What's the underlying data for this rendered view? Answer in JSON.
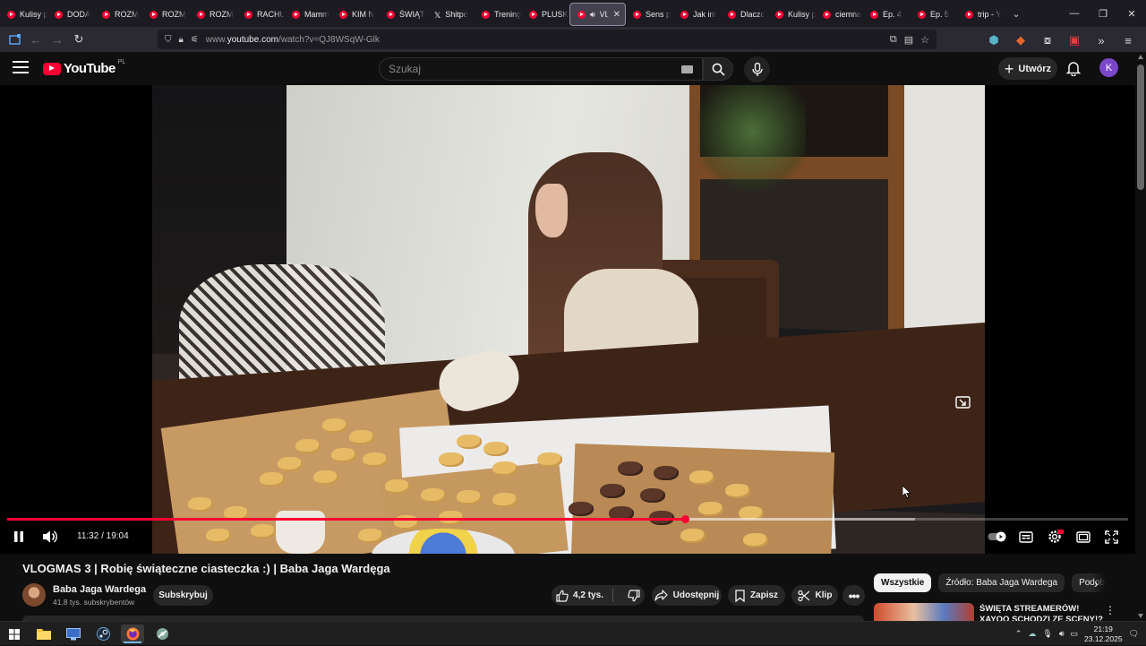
{
  "browser": {
    "tabs": [
      {
        "label": "Kulisy p",
        "icon": "youtube-icon"
      },
      {
        "label": "DODA",
        "icon": "youtube-icon"
      },
      {
        "label": "ROZM",
        "icon": "youtube-icon"
      },
      {
        "label": "ROZM",
        "icon": "youtube-icon"
      },
      {
        "label": "ROZM",
        "icon": "youtube-icon"
      },
      {
        "label": "RACHU",
        "icon": "youtube-icon"
      },
      {
        "label": "Mamm",
        "icon": "youtube-icon"
      },
      {
        "label": "KIM N",
        "icon": "youtube-icon"
      },
      {
        "label": "ŚWIĄT",
        "icon": "youtube-icon"
      },
      {
        "label": "Shitpo",
        "icon": "x-icon"
      },
      {
        "label": "Trening",
        "icon": "youtube-icon"
      },
      {
        "label": "PLUSK",
        "icon": "youtube-icon"
      },
      {
        "label": "VLO",
        "icon": "youtube-icon",
        "active": true
      },
      {
        "label": "Sens p",
        "icon": "youtube-icon"
      },
      {
        "label": "Jak inf",
        "icon": "youtube-icon"
      },
      {
        "label": "Dlaczc",
        "icon": "youtube-icon"
      },
      {
        "label": "Kulisy p",
        "icon": "youtube-icon"
      },
      {
        "label": "ciemna",
        "icon": "youtube-icon"
      },
      {
        "label": "Ep. 4",
        "icon": "youtube-icon"
      },
      {
        "label": "Ep. 5",
        "icon": "youtube-icon"
      },
      {
        "label": "trip - Y",
        "icon": "youtube-icon"
      }
    ],
    "url_prefix": "www.",
    "url_domain": "youtube.com",
    "url_rest": "/watch?v=QJ8WSqW-Glk"
  },
  "youtube": {
    "logo_text": "YouTube",
    "region": "PL",
    "search_placeholder": "Szukaj",
    "create_label": "Utwórz",
    "avatar_letter": "K",
    "accent": "#ff0033"
  },
  "player": {
    "current_time": "11:32",
    "duration": "19:04",
    "played_fraction": 0.605,
    "buffered_fraction": 0.81
  },
  "video": {
    "title": "VLOGMAS 3 | Robię świąteczne ciasteczka :) | Baba Jaga Wardęga",
    "channel_name": "Baba Jaga Wardega",
    "channel_subs": "41,8 tys. subskrybentów",
    "subscribe_label": "Subskrybuj",
    "likes": "4,2 tys.",
    "share_label": "Udostępnij",
    "save_label": "Zapisz",
    "clip_label": "Klip"
  },
  "sidebar": {
    "chips": [
      "Wszystkie",
      "Źródło: Baba Jaga Wardega",
      "Podob"
    ],
    "reco_title": "ŚWIĘTA STREAMERÓW! XAYOO SCHODZI ZE SCENY!?"
  },
  "taskbar": {
    "time": "21:19",
    "date": "23.12.2025"
  }
}
